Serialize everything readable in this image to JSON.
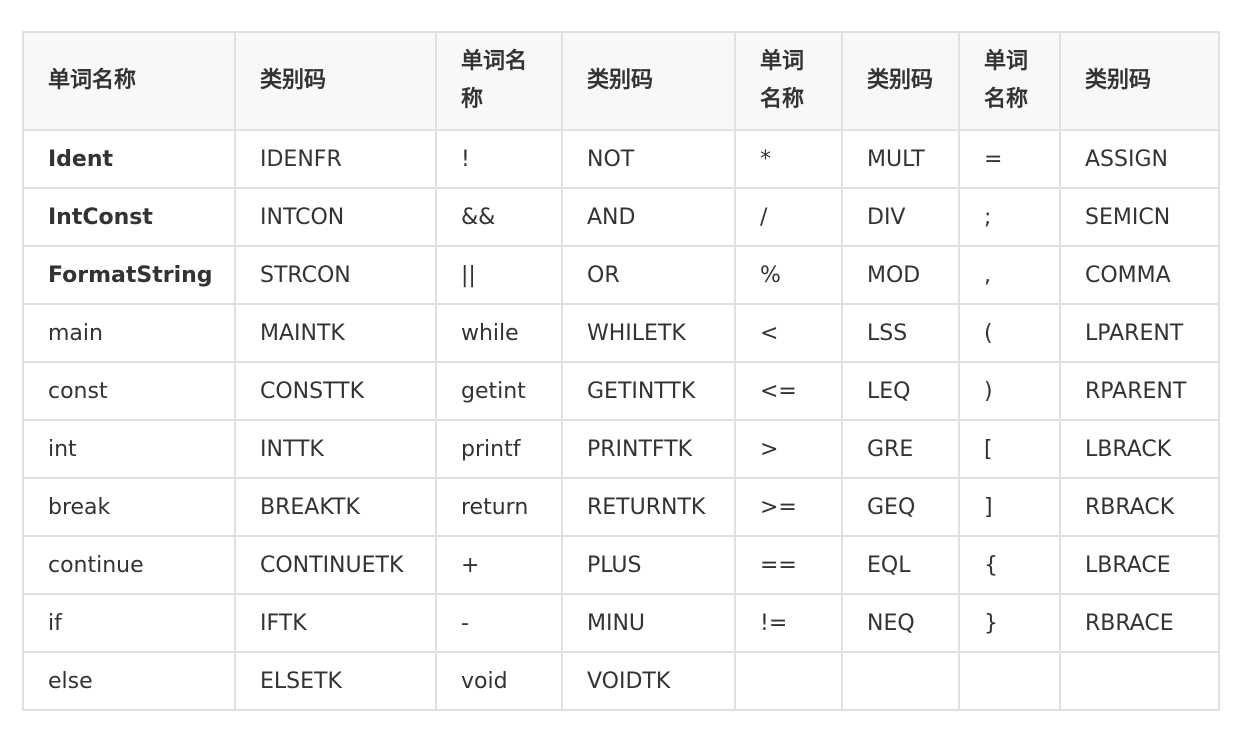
{
  "table": {
    "headers": [
      "单词名称",
      "类别码",
      "单词名称",
      "类别码",
      "单词名称",
      "类别码",
      "单词名称",
      "类别码"
    ],
    "rows": [
      [
        "Ident",
        "IDENFR",
        "!",
        "NOT",
        "*",
        "MULT",
        "=",
        "ASSIGN"
      ],
      [
        "IntConst",
        "INTCON",
        "&&",
        "AND",
        "/",
        "DIV",
        ";",
        "SEMICN"
      ],
      [
        "FormatString",
        "STRCON",
        "||",
        "OR",
        "%",
        "MOD",
        ",",
        "COMMA"
      ],
      [
        "main",
        "MAINTK",
        "while",
        "WHILETK",
        "<",
        "LSS",
        "(",
        "LPARENT"
      ],
      [
        "const",
        "CONSTTK",
        "getint",
        "GETINTTK",
        "<=",
        "LEQ",
        ")",
        "RPARENT"
      ],
      [
        "int",
        "INTTK",
        "printf",
        "PRINTFTK",
        ">",
        "GRE",
        "[",
        "LBRACK"
      ],
      [
        "break",
        "BREAKTK",
        "return",
        "RETURNTK",
        ">=",
        "GEQ",
        "]",
        "RBRACK"
      ],
      [
        "continue",
        "CONTINUETK",
        "+",
        "PLUS",
        "==",
        "EQL",
        "{",
        "LBRACE"
      ],
      [
        "if",
        "IFTK",
        "-",
        "MINU",
        "!=",
        "NEQ",
        "}",
        "RBRACE"
      ],
      [
        "else",
        "ELSETK",
        "void",
        "VOIDTK",
        "",
        "",
        "",
        ""
      ]
    ]
  },
  "colors": {
    "border": "#dfe2e5",
    "header_bg": "#f8f8f8",
    "text": "#333333"
  }
}
